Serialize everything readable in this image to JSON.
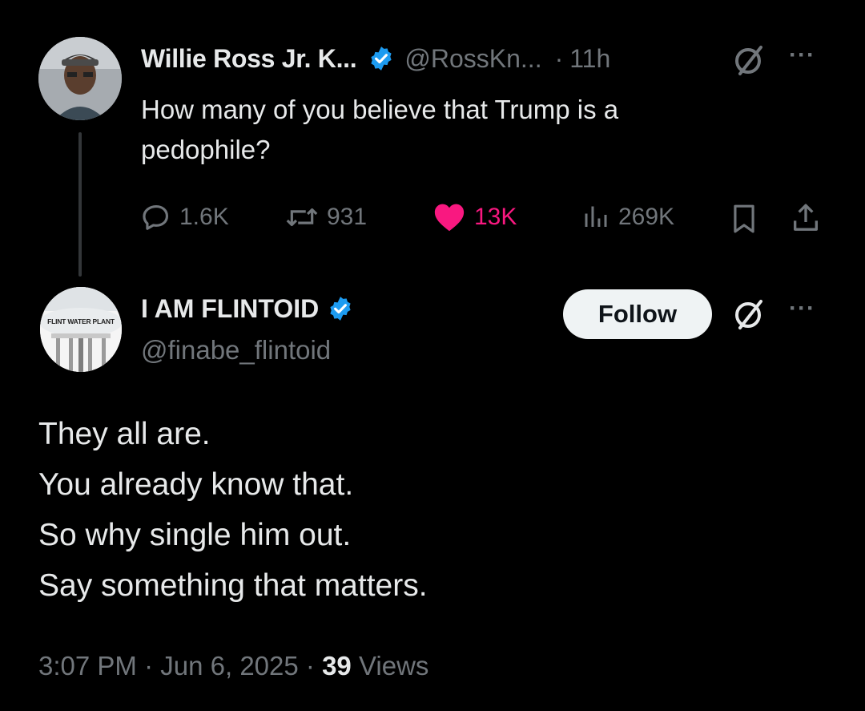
{
  "original_tweet": {
    "author_name": "Willie Ross Jr. K...",
    "handle": "@RossKn...",
    "separator": "·",
    "time": "11h",
    "more": "···",
    "text_line1": "How many of you believe that Trump is a",
    "text_line2": "pedophile?",
    "replies": "1.6K",
    "reposts": "931",
    "likes": "13K",
    "views": "269K",
    "like_color": "#f91880",
    "verified_color": "#1d9bf0"
  },
  "reply_tweet": {
    "author_name": "I AM FLINTOID",
    "handle": "@finabe_flintoid",
    "avatar_text": "FLINT WATER PLANT",
    "follow_label": "Follow",
    "more": "···",
    "lines": [
      "They all are.",
      "You already know that.",
      "So why single him out.",
      "Say something that matters."
    ],
    "time": "3:07 PM",
    "dot": "·",
    "date": "Jun 6, 2025",
    "view_count": "39",
    "views_label": "Views"
  },
  "icons": [
    "verified-badge-icon",
    "grok-icon",
    "more-icon",
    "reply-icon",
    "repost-icon",
    "like-icon",
    "views-icon",
    "bookmark-icon",
    "share-icon"
  ]
}
